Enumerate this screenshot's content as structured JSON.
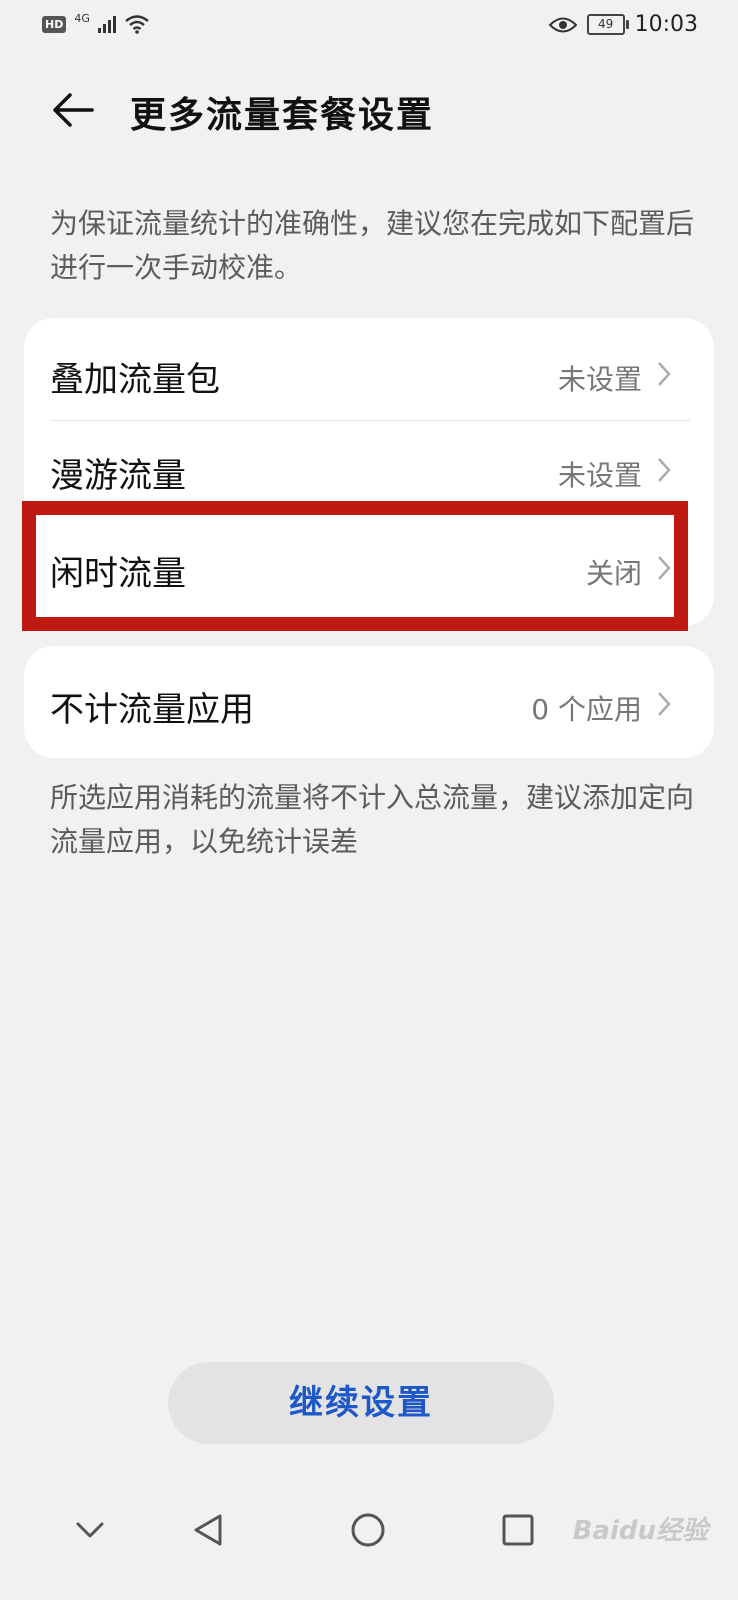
{
  "status_bar": {
    "hd": "HD",
    "network": "4G",
    "battery": "49",
    "time": "10:03"
  },
  "header": {
    "title": "更多流量套餐设置",
    "back_icon": "arrow-left-icon"
  },
  "description": "为保证流量统计的准确性，建议您在完成如下配置后进行一次手动校准。",
  "settings": [
    {
      "label": "叠加流量包",
      "value": "未设置"
    },
    {
      "label": "漫游流量",
      "value": "未设置"
    },
    {
      "label": "闲时流量",
      "value": "关闭"
    }
  ],
  "exempt": {
    "label": "不计流量应用",
    "value": "0 个应用"
  },
  "note": "所选应用消耗的流量将不计入总流量，建议添加定向流量应用，以免统计误差",
  "continue_button": "继续设置",
  "nav": [
    "chevron-down-icon",
    "back-triangle-icon",
    "home-circle-icon",
    "recent-square-icon"
  ],
  "watermark": "Baidu经验",
  "colors": {
    "highlight": "#be1a12",
    "accent": "#1e58c8",
    "background": "#f1f1f3"
  }
}
